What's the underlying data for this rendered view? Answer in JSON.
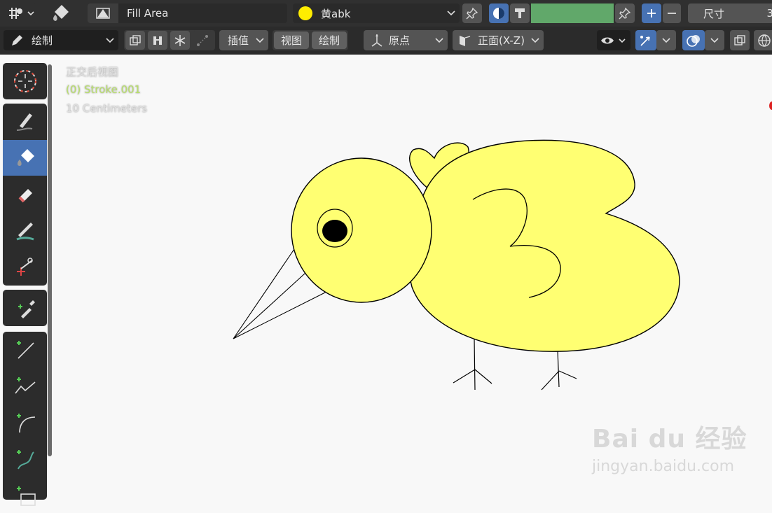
{
  "header": {
    "object_data_name": "Fill Area",
    "material_name": "黄abk",
    "material_color": "#ffed00",
    "color_bar": "#61a86a",
    "size_label": "尺寸",
    "size_value": "3"
  },
  "toolbar2": {
    "mode_label": "绘制",
    "interp_label": "插值",
    "view_label": "视图",
    "draw_label": "绘制",
    "origin_label": "原点",
    "plane_label": "正面(X-Z)"
  },
  "viewport": {
    "view_name": "正交后视图",
    "object_label": "(0) Stroke.001",
    "scale_label": "10 Centimeters"
  },
  "drawing": {
    "fill_color": "#ffff72",
    "stroke_color": "#000000"
  },
  "watermark": {
    "brand": "Bai du 经验",
    "url": "jingyan.baidu.com"
  }
}
